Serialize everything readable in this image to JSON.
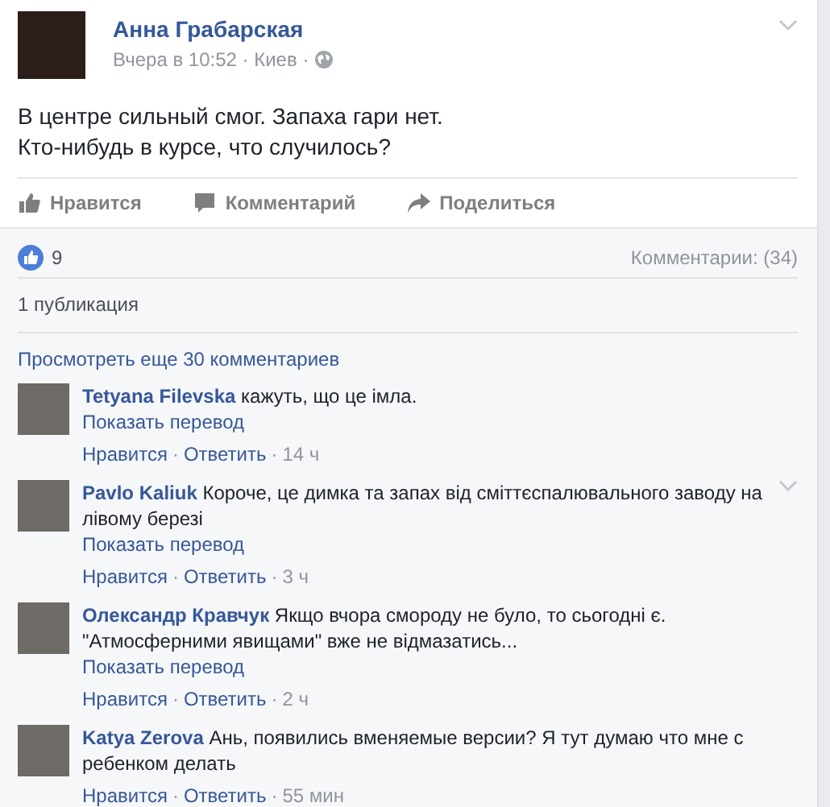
{
  "post": {
    "author": "Анна Грабарская",
    "meta": "Вчера в 10:52 · Киев ·",
    "text_lines": [
      "В центре сильный смог. Запаха гари нет.",
      "Кто-нибудь в курсе, что случилось?"
    ],
    "actions": [
      {
        "kind": "like",
        "label": "Нравится"
      },
      {
        "kind": "comment",
        "label": "Комментарий"
      },
      {
        "kind": "share",
        "label": "Поделиться"
      }
    ]
  },
  "summary": {
    "likes": "9",
    "comments": "Комментарии: (34)",
    "shares": "1 публикация"
  },
  "more_comments": "Просмотреть еще 30 комментариев",
  "comments": [
    {
      "author": "Tetyana Filevska",
      "text": "кажуть, що це імла.",
      "translate": "Показать перевод",
      "like": "Нравится",
      "reply": "Ответить",
      "time": "14 ч",
      "menu_shown": false
    },
    {
      "author": "Pavlo Kaliuk",
      "text": "Короче, це димка та запах від сміттєспалювального заводу на лівому березі",
      "translate": "Показать перевод",
      "like": "Нравится",
      "reply": "Ответить",
      "time": "3 ч",
      "menu_shown": true
    },
    {
      "author": "Олександр Кравчук",
      "text": "Якщо вчора смороду не було, то сьогодні є. \"Атмосферними явищами\" вже не відмазатись...",
      "translate": "Показать перевод",
      "like": "Нравится",
      "reply": "Ответить",
      "time": "2 ч",
      "menu_shown": false
    },
    {
      "author": "Katya Zerova",
      "text": "Ань, появились вменяемые версии? Я тут думаю что мне с ребенком делать",
      "like": "Нравится",
      "reply": "Ответить",
      "time": "55 мин",
      "menu_shown": false
    }
  ],
  "action_separator": "·"
}
